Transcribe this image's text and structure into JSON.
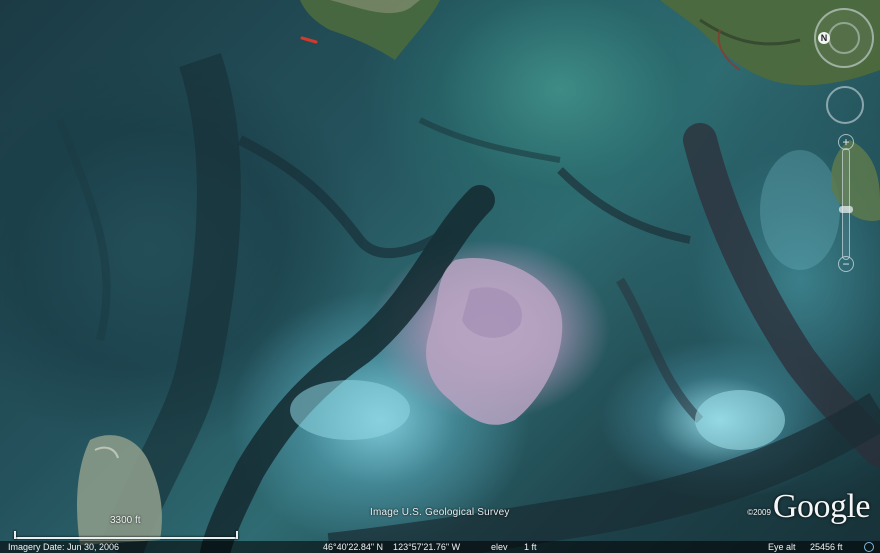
{
  "map": {
    "imagery_credit": "Image U.S. Geological Survey",
    "scale_label": "3300 ft",
    "logo_copyright": "©2009",
    "logo_text": "Google"
  },
  "status": {
    "imagery_date": "Imagery Date: Jun 30, 2006",
    "coordinates": "46°40'22.84\" N    123°57'21.76\" W",
    "elev_label": "elev",
    "elev_value": "1 ft",
    "eye_alt_label": "Eye alt",
    "eye_alt_value": "25456 ft"
  },
  "navigation": {
    "north_label": "N",
    "zoom_in": "+",
    "zoom_out": "−",
    "zoom_level": 0.55
  },
  "colors": {
    "water_dark": "#1b3a44",
    "mudflat": "#2f6b72",
    "sandbar": "#b9a6c4",
    "shallows": "#8fd4e0",
    "forest": "#4f6a3c"
  }
}
